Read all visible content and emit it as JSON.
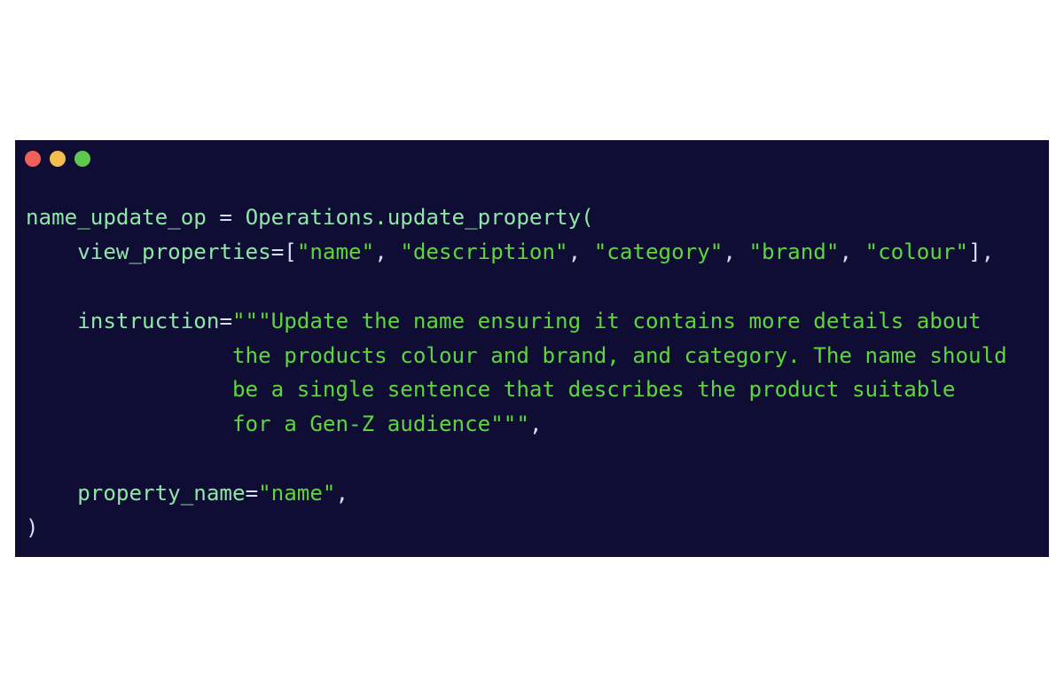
{
  "window": {
    "buttons": {
      "close": "close-dot",
      "minimize": "minimize-dot",
      "maximize": "maximize-dot"
    },
    "colors": {
      "background": "#100d35",
      "close": "#f0605a",
      "minimize": "#f3bd4f",
      "maximize": "#5fc84f"
    }
  },
  "code": {
    "line1": {
      "var": "name_update_op",
      "eq": " = ",
      "call": "Operations.update_property("
    },
    "line2": {
      "indent": "    ",
      "param": "view_properties",
      "eq": "=",
      "open": "[",
      "s1": "\"name\"",
      "c1": ", ",
      "s2": "\"description\"",
      "c2": ", ",
      "s3": "\"category\"",
      "c3": ", ",
      "s4": "\"brand\"",
      "c4": ", ",
      "s5": "\"colour\"",
      "close": "],"
    },
    "line4": {
      "indent": "    ",
      "param": "instruction",
      "eq": "=",
      "text": "\"\"\"Update the name ensuring it contains more details about"
    },
    "line5": {
      "indent": "                ",
      "text": "the products colour and brand, and category. The name should"
    },
    "line6": {
      "indent": "                ",
      "text": "be a single sentence that describes the product suitable"
    },
    "line7": {
      "indent": "                ",
      "text": "for a Gen-Z audience\"\"\"",
      "tail": ","
    },
    "line9": {
      "indent": "    ",
      "param": "property_name",
      "eq": "=",
      "text": "\"name\"",
      "tail": ","
    },
    "line10": {
      "text": ")"
    }
  }
}
